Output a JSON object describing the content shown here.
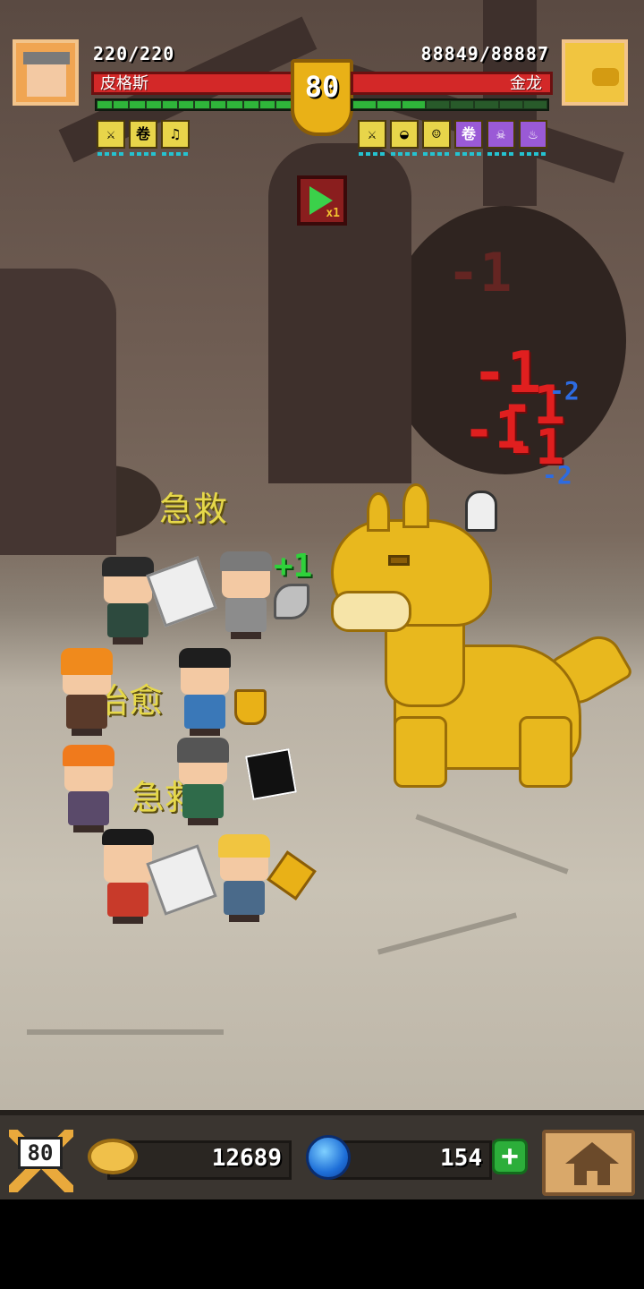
{
  "player": {
    "name": "皮格斯",
    "hp_current": 220,
    "hp_max": 220,
    "hp_text": "220/220",
    "portrait_icon": "hero-portrait-icon"
  },
  "enemy": {
    "name": "金龙",
    "hp_current": 88849,
    "hp_max": 88887,
    "hp_text": "88849/88887",
    "portrait_icon": "golden-dragon-portrait-icon"
  },
  "level": {
    "value": "80"
  },
  "speed": {
    "label": "x1"
  },
  "player_buffs": [
    "sword-buff-icon",
    "scroll-buff-icon",
    "drum-buff-icon"
  ],
  "enemy_buffs": [
    "sword-buff-icon",
    "bread-buff-icon",
    "face-buff-icon",
    "scroll-buff-icon",
    "skull-buff-icon",
    "ghost-buff-icon"
  ],
  "battle_text": {
    "first_aid_1": "急救",
    "heal": "治愈",
    "first_aid_2": "急救",
    "heal_number": "+1",
    "dmg_1": "-1",
    "dmg_2": "-1",
    "dmg_3": "-1",
    "dmg_4": "-1",
    "dmg_5": "-1",
    "dmg_blue_1": "-2",
    "dmg_blue_2": "-2"
  },
  "bottom_bar": {
    "level_badge": "80",
    "gold": "12689",
    "gems": "154",
    "add_label": "+"
  },
  "colors": {
    "hp_red": "#d32828",
    "energy_green": "#2fb53a",
    "gold": "#e9b117",
    "dragon": "#e8b81e"
  }
}
